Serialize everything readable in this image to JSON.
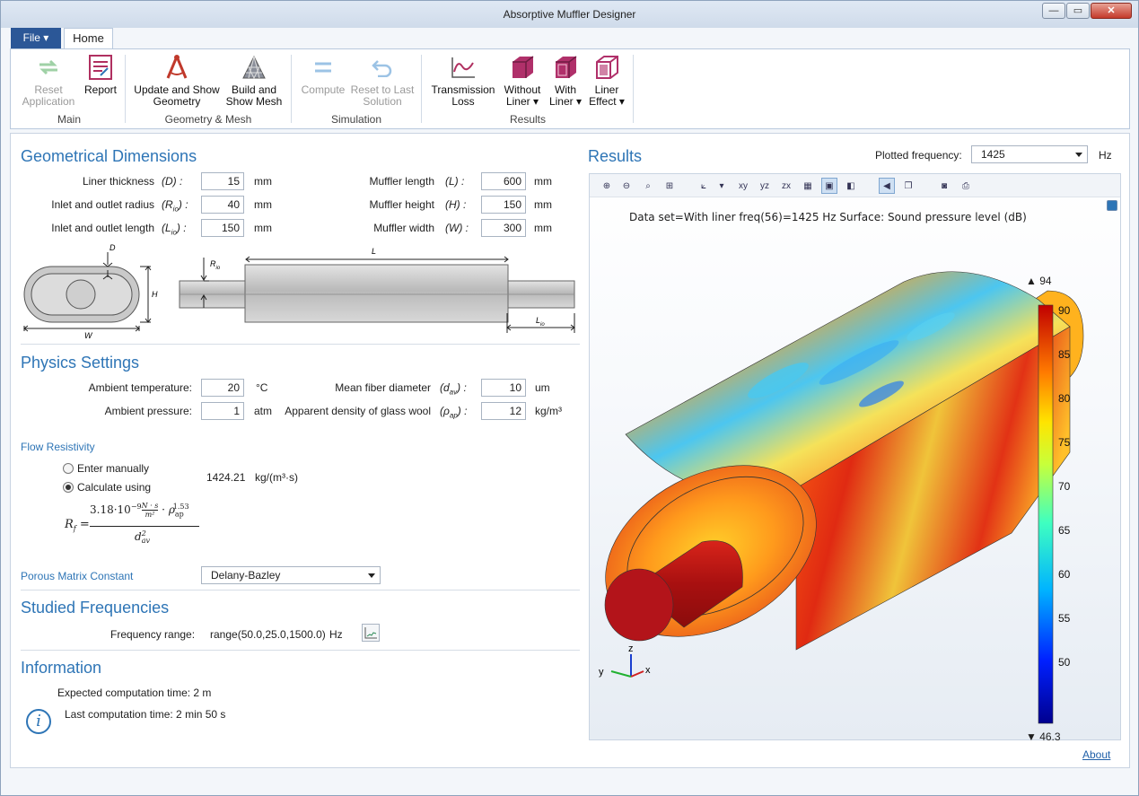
{
  "window": {
    "title": "Absorptive Muffler Designer",
    "min": "—",
    "max": "▭",
    "close": "✕"
  },
  "tabs": {
    "file": "File ▾",
    "home": "Home"
  },
  "ribbon": {
    "groups": [
      {
        "label": "Main",
        "buttons": [
          {
            "label": "Reset Application",
            "enabled": false
          },
          {
            "label": "Report",
            "enabled": true
          }
        ]
      },
      {
        "label": "Geometry & Mesh",
        "buttons": [
          {
            "label": "Update and Show Geometry",
            "enabled": true
          },
          {
            "label": "Build and Show Mesh",
            "enabled": true
          }
        ]
      },
      {
        "label": "Simulation",
        "buttons": [
          {
            "label": "Compute",
            "enabled": false
          },
          {
            "label": "Reset to Last Solution",
            "enabled": false
          }
        ]
      },
      {
        "label": "Results",
        "buttons": [
          {
            "label": "Transmission Loss",
            "enabled": true
          },
          {
            "label": "Without Liner ▾",
            "enabled": true
          },
          {
            "label": "With Liner ▾",
            "enabled": true
          },
          {
            "label": "Liner Effect ▾",
            "enabled": true
          }
        ]
      }
    ],
    "reset_l1": "Reset",
    "reset_l2": "Application",
    "report": "Report",
    "update_l1": "Update and Show",
    "update_l2": "Geometry",
    "mesh_l1": "Build and",
    "mesh_l2": "Show Mesh",
    "compute": "Compute",
    "reset_last_l1": "Reset to Last",
    "reset_last_l2": "Solution",
    "tl_l1": "Transmission",
    "tl_l2": "Loss",
    "wo_l1": "Without",
    "wo_l2": "Liner ▾",
    "wl_l1": "With",
    "wl_l2": "Liner ▾",
    "le_l1": "Liner",
    "le_l2": "Effect ▾",
    "g_main": "Main",
    "g_geom": "Geometry & Mesh",
    "g_sim": "Simulation",
    "g_res": "Results"
  },
  "geom": {
    "title": "Geometrical Dimensions",
    "liner_thickness": {
      "label": "Liner thickness",
      "sym": "(D) :",
      "value": "15",
      "unit": "mm"
    },
    "inlet_radius": {
      "label": "Inlet and outlet radius",
      "sym": "(R",
      "sub": "io",
      "close": ") :",
      "value": "40",
      "unit": "mm"
    },
    "inlet_length": {
      "label": "Inlet and outlet length",
      "sym": "(L",
      "sub": "io",
      "close": ") :",
      "value": "150",
      "unit": "mm"
    },
    "muffler_length": {
      "label": "Muffler length",
      "sym": "(L) :",
      "value": "600",
      "unit": "mm"
    },
    "muffler_height": {
      "label": "Muffler height",
      "sym": "(H) :",
      "value": "150",
      "unit": "mm"
    },
    "muffler_width": {
      "label": "Muffler width",
      "sym": "(W) :",
      "value": "300",
      "unit": "mm"
    },
    "sketch": {
      "D": "D",
      "H": "H",
      "W": "W",
      "L": "L",
      "Rio": "R",
      "Lio": "L",
      "io": "io"
    }
  },
  "physics": {
    "title": "Physics Settings",
    "temp": {
      "label": "Ambient temperature:",
      "value": "20",
      "unit": "°C"
    },
    "pressure": {
      "label": "Ambient pressure:",
      "value": "1",
      "unit": "atm"
    },
    "fiber": {
      "label": "Mean fiber diameter",
      "sym": "(d",
      "sub": "av",
      "close": ") :",
      "value": "10",
      "unit": "um"
    },
    "density": {
      "label": "Apparent density of glass wool",
      "sym": "(ρ",
      "sub": "ap",
      "close": ") :",
      "value": "12",
      "unit": "kg/m³"
    }
  },
  "flow": {
    "title": "Flow Resistivity",
    "opt_manual": "Enter manually",
    "opt_calc": "Calculate using",
    "value": "1424.21",
    "unit": "kg/(m³·s)",
    "formula": {
      "lhs": "R",
      "lhs_sub": "f",
      "eq": "=",
      "coef": "3.18·10",
      "exp": "−9",
      "ns": "N · s",
      "m2": "m²",
      "dot": "·",
      "rho": "ρ",
      "rho_sub": "ap",
      "rho_exp": "1.53",
      "den": "d",
      "den_sup": "2",
      "den_sub": "av"
    }
  },
  "porous": {
    "label": "Porous Matrix Constant",
    "value": "Delany-Bazley"
  },
  "freq": {
    "title": "Studied Frequencies",
    "label": "Frequency range:",
    "value": "range(50.0,25.0,1500.0)",
    "unit": "Hz"
  },
  "info": {
    "title": "Information",
    "expected": "Expected computation time:  2 m",
    "last": "Last computation time: 2 min 50 s"
  },
  "results": {
    "title": "Results",
    "plotted_label": "Plotted frequency:",
    "plotted_value": "1425",
    "unit": "Hz",
    "dataset": "Data set=With liner freq(56)=1425 Hz   Surface: Sound pressure level (dB)",
    "legend_max": "▲ 94",
    "legend_min": "▼ 46.3",
    "ticks": [
      "90",
      "85",
      "80",
      "75",
      "70",
      "65",
      "60",
      "55",
      "50"
    ],
    "axes": {
      "x": "x",
      "y": "y",
      "z": "z"
    }
  },
  "chart_data": {
    "type": "heatmap",
    "title": "Surface: Sound pressure level (dB)",
    "colorbar": {
      "min": 46.3,
      "max": 94,
      "ticks": [
        90,
        85,
        80,
        75,
        70,
        65,
        60,
        55,
        50
      ]
    }
  },
  "about": "About"
}
